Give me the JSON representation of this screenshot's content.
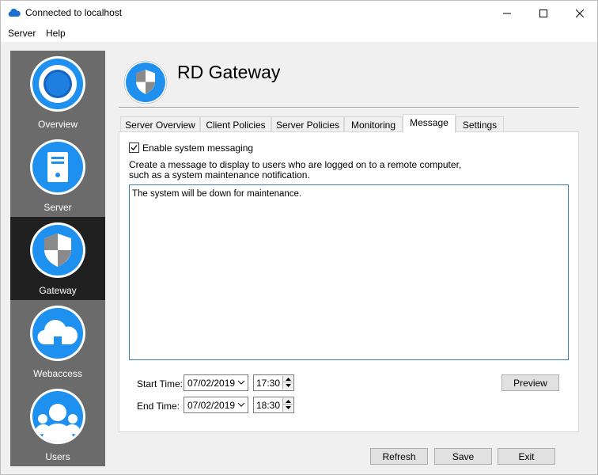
{
  "window": {
    "title": "Connected to localhost",
    "app_icon": "cloud-icon"
  },
  "menu": {
    "items": [
      {
        "label": "Server"
      },
      {
        "label": "Help"
      }
    ]
  },
  "sidebar": {
    "items": [
      {
        "label": "Overview",
        "icon": "overview-icon",
        "active": false
      },
      {
        "label": "Server",
        "icon": "server-icon",
        "active": false
      },
      {
        "label": "Gateway",
        "icon": "shield-icon",
        "active": true
      },
      {
        "label": "Webaccess",
        "icon": "cloud-icon",
        "active": false
      },
      {
        "label": "Users",
        "icon": "users-icon",
        "active": false
      }
    ]
  },
  "header": {
    "title": "RD Gateway",
    "icon": "shield-icon"
  },
  "tabs": [
    {
      "label": "Server Overview"
    },
    {
      "label": "Client Policies"
    },
    {
      "label": "Server Policies"
    },
    {
      "label": "Monitoring"
    },
    {
      "label": "Message",
      "active": true
    },
    {
      "label": "Settings"
    }
  ],
  "message_tab": {
    "enable_label": "Enable system messaging",
    "enable_checked": true,
    "description_line1": "Create a message to display to users who are logged on to a remote computer,",
    "description_line2": "such as a system maintenance notification.",
    "message_text": "The system will be down for maintenance.",
    "start_label": "Start Time:",
    "start_date": "07/02/2019",
    "start_time": "17:30",
    "end_label": "End Time:",
    "end_date": "07/02/2019",
    "end_time": "18:30",
    "preview_label": "Preview"
  },
  "footer": {
    "refresh_label": "Refresh",
    "save_label": "Save",
    "exit_label": "Exit"
  },
  "colors": {
    "accent": "#1e90f0",
    "sidebar_bg": "#6b6b6b",
    "sidebar_active": "#202020"
  }
}
